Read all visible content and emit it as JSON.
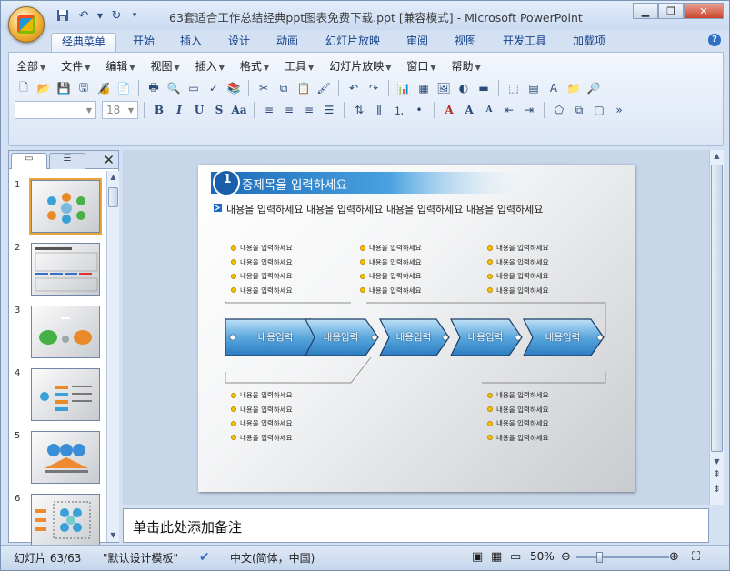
{
  "window": {
    "title": "63套适合工作总结经典ppt图表免费下载.ppt [兼容模式] - Microsoft PowerPoint",
    "minimize_icon": "minimize-icon",
    "maximize_icon": "maximize-icon",
    "close_icon": "close-icon"
  },
  "ribbon_tabs": [
    "经典菜单",
    "开始",
    "插入",
    "设计",
    "动画",
    "幻灯片放映",
    "审阅",
    "视图",
    "开发工具",
    "加载项"
  ],
  "menu_bar": [
    "全部",
    "文件",
    "编辑",
    "视图",
    "插入",
    "格式",
    "工具",
    "幻灯片放映",
    "窗口",
    "帮助"
  ],
  "font_box": {
    "font_name": "",
    "font_size": "18"
  },
  "slide_panel": {
    "slides": [
      {
        "number": "1"
      },
      {
        "number": "2"
      },
      {
        "number": "3"
      },
      {
        "number": "4"
      },
      {
        "number": "5"
      },
      {
        "number": "6"
      }
    ]
  },
  "slide": {
    "number_badge": "1",
    "title": "중제목을 입력하세요",
    "subtitle": "내용을 입력하세요 내용을 입력하세요 내용을 입력하세요 내용을 입력하세요",
    "bullet_text": "내용을 입력하세요",
    "arrows": [
      "내용입력",
      "내용입력",
      "내용입력",
      "내용입력",
      "내용입력"
    ],
    "accent": "#2f7ec8"
  },
  "notes": {
    "placeholder": "单击此处添加备注"
  },
  "status_bar": {
    "slide_position": "幻灯片 63/63",
    "theme": "\"默认设计模板\"",
    "language": "中文(简体，中国)",
    "zoom": "50%"
  }
}
